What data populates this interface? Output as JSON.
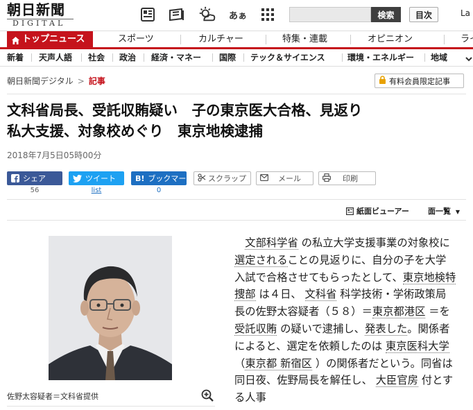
{
  "header": {
    "logo_main": "朝日新聞",
    "logo_sub": "DIGITAL",
    "font_size_icon_label": "あぁ",
    "search_button": "検索",
    "index_button": "目次",
    "language_partial": "La"
  },
  "nav_primary": {
    "active": "トップニュース",
    "items": [
      "スポーツ",
      "カルチャー",
      "特集・連載",
      "オピニオン",
      "ライ"
    ]
  },
  "nav_secondary": {
    "items": [
      "新着",
      "天声人語",
      "社会",
      "政治",
      "経済・マネー",
      "国際",
      "テック＆サイエンス",
      "環境・エネルギー",
      "地域"
    ]
  },
  "breadcrumb": {
    "home": "朝日新聞デジタル",
    "separator": ">",
    "current": "記事"
  },
  "member_badge": "有料会員限定記事",
  "article": {
    "headline_line1": "文科省局長、受託収賄疑い　子の東京医大合格、見返り",
    "headline_line2": "私大支援、対象校めぐり　東京地検逮捕",
    "date": "2018年7月5日05時00分",
    "photo_caption": "佐野太容疑者＝文科省提供",
    "body": {
      "s1": "文部科学省",
      "s2": " の私立大学支援事業の対象校に",
      "s3": "選定される",
      "s4": "ことの見返りに、自分の子を大学入試で合格させてもらったとして、",
      "s5": "東京地検特捜部",
      "s6": " は４日、 ",
      "s7": "文科省",
      "s8": " 科学技術・学術政策局長の佐野太容疑者（５８）＝",
      "s9": "東京都港区",
      "s10": " ＝を ",
      "s11": "受託収賄",
      "s12": " の疑いで逮捕し、",
      "s13": "発表した",
      "s14": "。関係者によると、選定を依頼したのは ",
      "s15": "東京医科大学",
      "s16": " （",
      "s17": "東京都 新宿区",
      "s18": " ）の関係者だという。同省は同日夜、佐野局長を解任し、 ",
      "s19": "大臣官房",
      "s20": " 付とする人事"
    }
  },
  "share": {
    "facebook": "シェア",
    "facebook_count": "56",
    "twitter": "ツイート",
    "twitter_count": "list",
    "hatena_prefix": "B!",
    "hatena": "ブックマーク",
    "hatena_count": "0",
    "scrap": "スクラップ",
    "mail": "メール",
    "print": "印刷"
  },
  "tools": {
    "viewer": "紙面ビューアー",
    "page_list": "面一覧",
    "page_list_arrow": "▼"
  },
  "colors": {
    "brand_red": "#c5131c",
    "facebook": "#3b5998",
    "twitter": "#1da1f2",
    "hatena": "#1d6fc2"
  }
}
